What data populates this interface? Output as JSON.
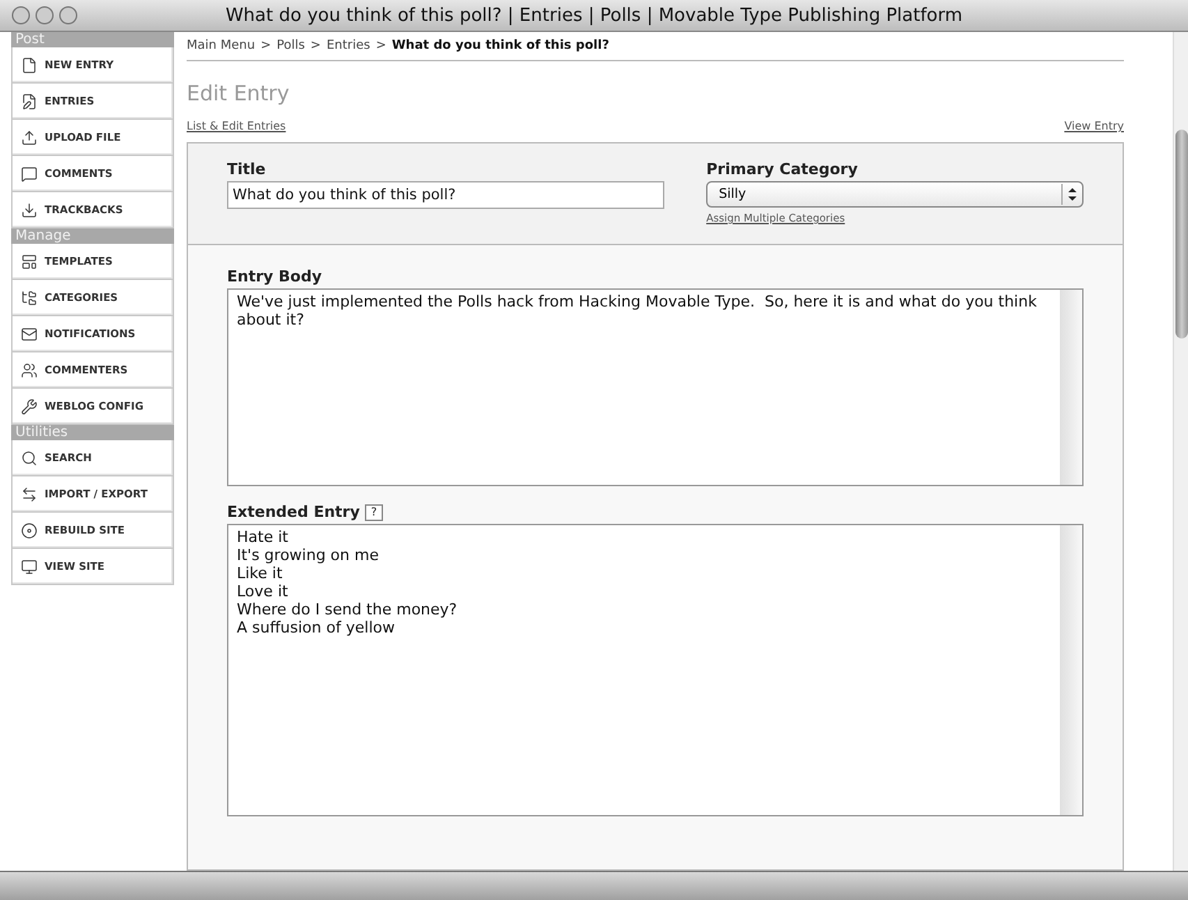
{
  "window": {
    "title": "What do you think of this poll? | Entries | Polls | Movable Type Publishing Platform"
  },
  "sidebar": [
    {
      "heading": "Post",
      "items": [
        {
          "label": "NEW ENTRY"
        },
        {
          "label": "ENTRIES"
        },
        {
          "label": "UPLOAD FILE"
        },
        {
          "label": "COMMENTS"
        },
        {
          "label": "TRACKBACKS"
        }
      ]
    },
    {
      "heading": "Manage",
      "items": [
        {
          "label": "TEMPLATES"
        },
        {
          "label": "CATEGORIES"
        },
        {
          "label": "NOTIFICATIONS"
        },
        {
          "label": "COMMENTERS"
        },
        {
          "label": "WEBLOG CONFIG"
        }
      ]
    },
    {
      "heading": "Utilities",
      "items": [
        {
          "label": "SEARCH"
        },
        {
          "label": "IMPORT / EXPORT"
        },
        {
          "label": "REBUILD SITE"
        },
        {
          "label": "VIEW SITE"
        }
      ]
    }
  ],
  "breadcrumb": [
    {
      "label": "Main Menu",
      "current": false
    },
    {
      "label": "Polls",
      "current": false
    },
    {
      "label": "Entries",
      "current": false
    },
    {
      "label": "What do you think of this poll?",
      "current": true
    }
  ],
  "breadcrumb_separator": ">",
  "page_title": "Edit Entry",
  "links": {
    "left": "List & Edit Entries",
    "right": "View Entry"
  },
  "title_field": {
    "label": "Title",
    "value": "What do you think of this poll?"
  },
  "category": {
    "label": "Primary Category",
    "value": "Silly",
    "link": "Assign Multiple Categories"
  },
  "entry_body": {
    "label": "Entry Body",
    "value": "We've just implemented the Polls hack from Hacking Movable Type.  So, here it is and what do you think about it?"
  },
  "extended_entry": {
    "label": "Extended Entry",
    "help": "?",
    "lines": [
      "Hate it",
      "It's growing on me",
      "Like it",
      "Love it",
      "Where do I send the money?",
      "A suffusion of yellow"
    ]
  }
}
